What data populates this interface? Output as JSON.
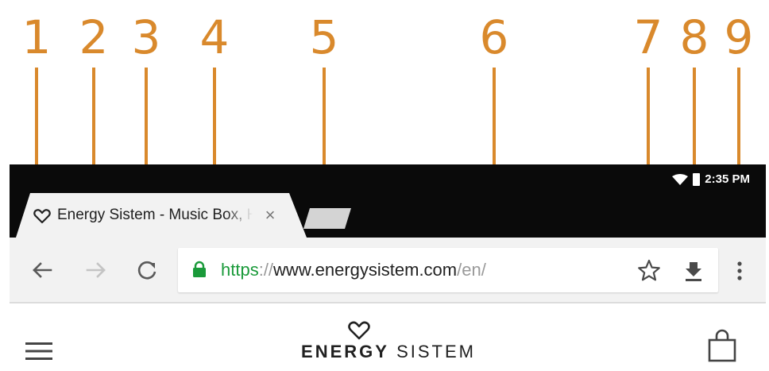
{
  "callouts": [
    "1",
    "2",
    "3",
    "4",
    "5",
    "6",
    "7",
    "8",
    "9"
  ],
  "status_bar": {
    "time": "2:35 PM"
  },
  "tab": {
    "title": "Energy Sistem - Music Box, Headphones",
    "close_symbol": "×"
  },
  "address_bar": {
    "scheme": "https",
    "separator": "://",
    "host": "www.energysistem.com",
    "path": "/en/"
  },
  "page": {
    "logo_bold": "ENERGY",
    "logo_light": "SISTEM"
  },
  "colors": {
    "callout": "#d9892c",
    "secure_green": "#1a9a3a",
    "status_bar": "#0a0a0a",
    "toolbar": "#f2f2f2"
  },
  "icons": [
    "back-arrow-icon",
    "forward-arrow-icon",
    "reload-icon",
    "lock-icon",
    "star-icon",
    "download-icon",
    "more-vert-icon",
    "wifi-icon",
    "battery-icon",
    "heart-icon",
    "hamburger-icon",
    "shopping-bag-icon"
  ]
}
